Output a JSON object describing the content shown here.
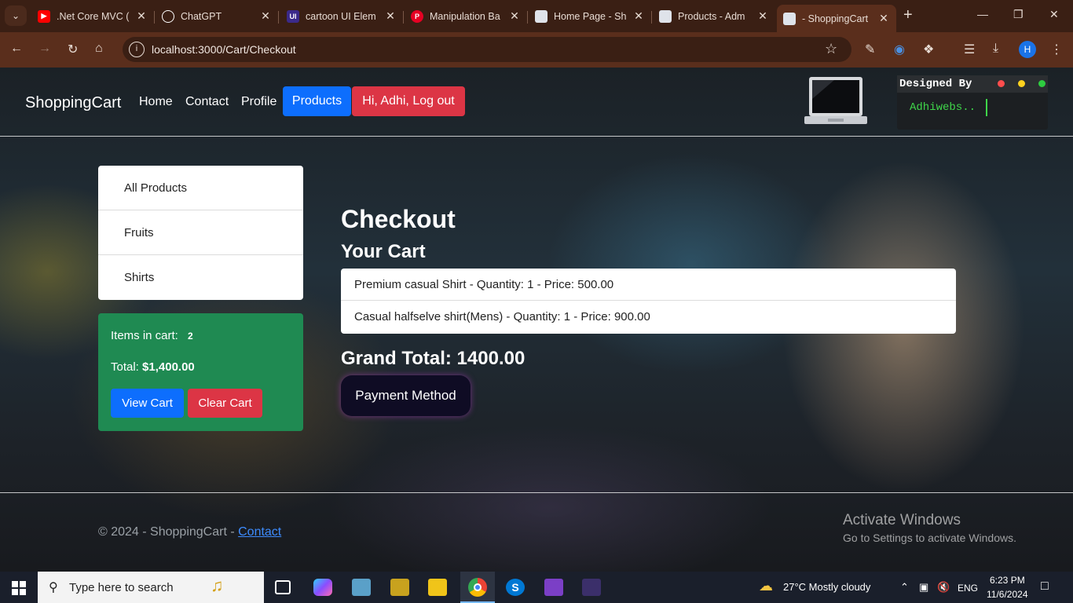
{
  "browser": {
    "tabs": [
      {
        "title": ".Net Core MVC (",
        "icon": "youtube-icon",
        "color": "#ff0000"
      },
      {
        "title": "ChatGPT",
        "icon": "chatgpt-icon",
        "color": "#ffffff"
      },
      {
        "title": "cartoon UI Elem",
        "icon": "uiverse-icon",
        "color": "#3b2a8a"
      },
      {
        "title": "Manipulation Ba",
        "icon": "pinterest-icon",
        "color": "#e60023"
      },
      {
        "title": "Home Page - Sh",
        "icon": "page-icon",
        "color": "#dfe3ea"
      },
      {
        "title": "Products - Adm",
        "icon": "page-icon",
        "color": "#dfe3ea"
      },
      {
        "title": "- ShoppingCart",
        "icon": "page-icon",
        "color": "#dfe3ea",
        "active": true
      }
    ],
    "url": "localhost:3000/Cart/Checkout",
    "profile_initial": "H"
  },
  "navbar": {
    "brand": "ShoppingCart",
    "links": [
      "Home",
      "Contact",
      "Profile"
    ],
    "products_btn": "Products",
    "logout_btn": "Hi, Adhi, Log out",
    "terminal_title": "Designed By",
    "terminal_text": "Adhiwebs.."
  },
  "sidebar": {
    "categories": [
      "All Products",
      "Fruits",
      "Shirts"
    ],
    "items_label": "Items in cart:",
    "items_count": "2",
    "total_label": "Total:",
    "total_value": "$1,400.00",
    "view_cart": "View Cart",
    "clear_cart": "Clear Cart"
  },
  "checkout": {
    "heading": "Checkout",
    "subheading": "Your Cart",
    "items": [
      "Premium casual Shirt - Quantity: 1 - Price: 500.00",
      "Casual halfselve shirt(Mens) - Quantity: 1 - Price: 900.00"
    ],
    "grand_total": "Grand Total: 1400.00",
    "payment_btn": "Payment Method"
  },
  "footer": {
    "text": "© 2024 - ShoppingCart - ",
    "link": "Contact"
  },
  "watermark": {
    "line1": "Activate Windows",
    "line2": "Go to Settings to activate Windows."
  },
  "taskbar": {
    "search_placeholder": "Type here to search",
    "weather": "27°C  Mostly cloudy",
    "lang": "ENG",
    "time": "6:23 PM",
    "date": "11/6/2024"
  },
  "colors": {
    "primary": "#0d6efd",
    "danger": "#dc3545",
    "success": "#1f8a52"
  }
}
